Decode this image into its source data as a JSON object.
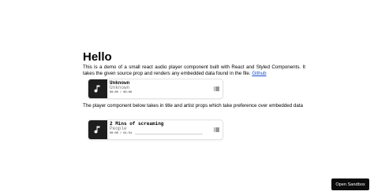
{
  "heading": "Hello",
  "intro": {
    "text": "This is a demo of a small react audio player component built with React and Styled Components. It takes the given source prop and renders any embedded data found in the file. ",
    "link": "Github"
  },
  "players": [
    {
      "title": "Unknown",
      "artist": "Unknown",
      "time": "00:00 / 00:00",
      "progress": 0
    },
    {
      "title": "2 Mins of screaming",
      "artist": "People",
      "time": "00:00 / 01:54",
      "progress": 0
    }
  ],
  "second_text": "The player component below takes in title and artist props which take preference over embedded data",
  "open_sandbox": "Open Sandbox",
  "icons": {
    "art": "music-note-icon",
    "menu": "playlist-menu-icon"
  }
}
